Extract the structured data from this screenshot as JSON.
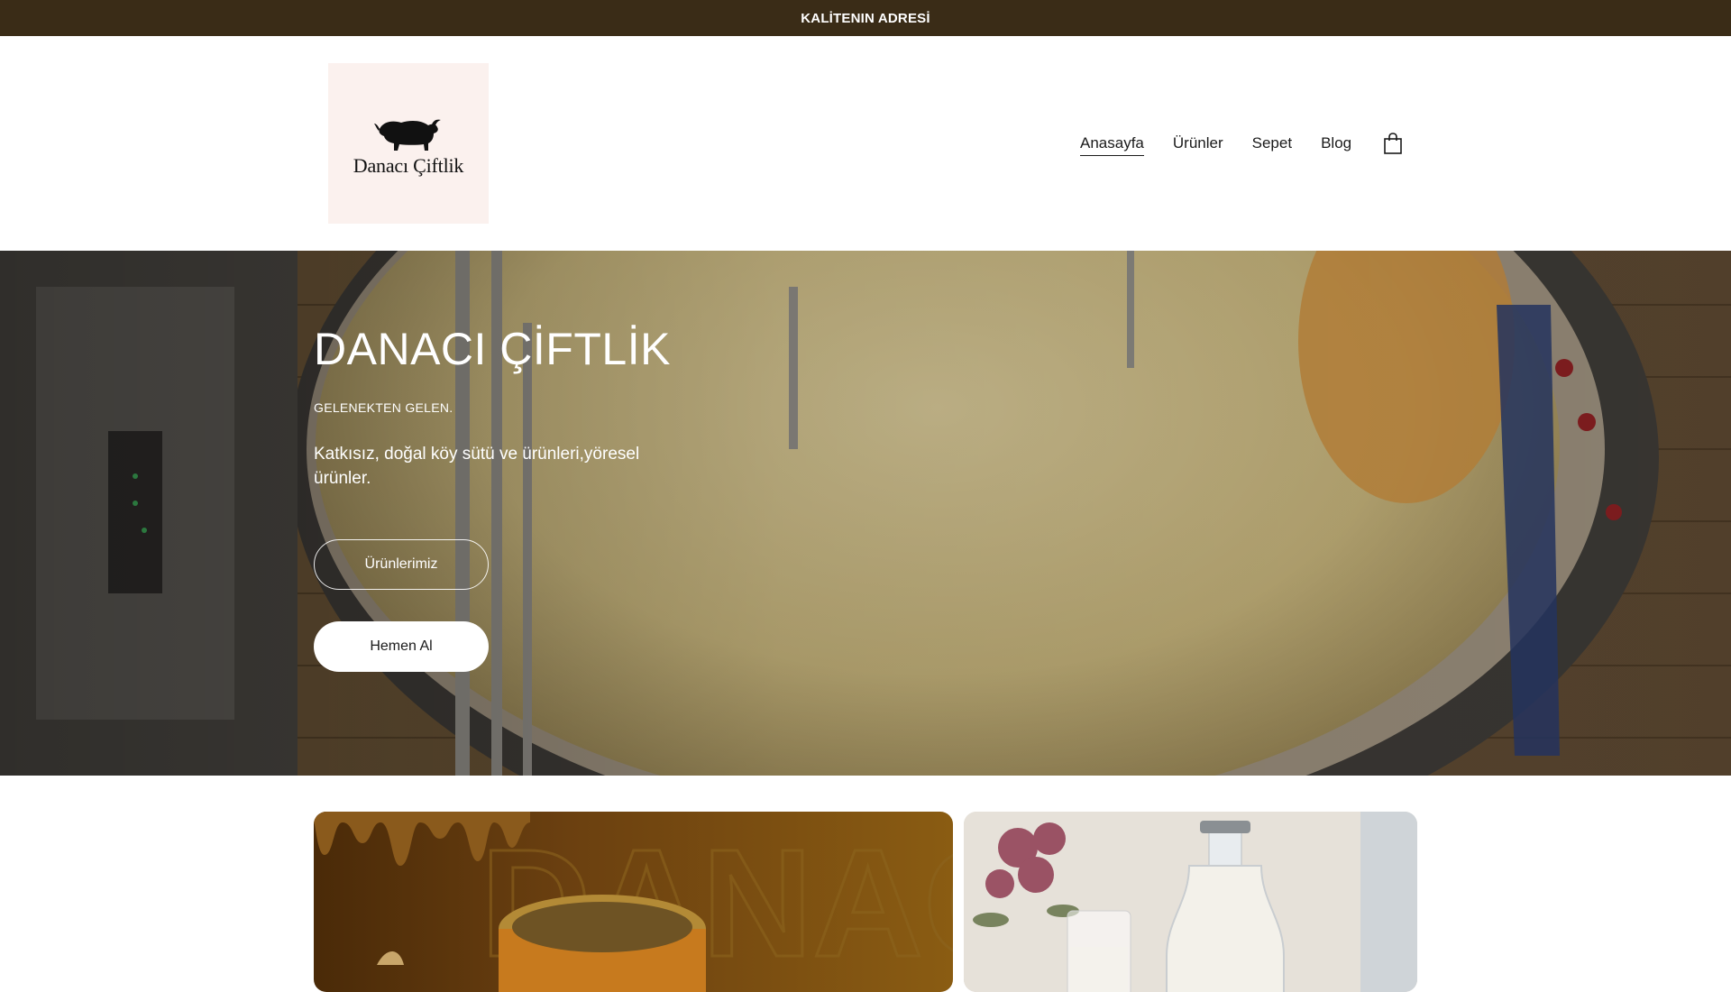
{
  "announcement": {
    "text": "KALİTENIN ADRESİ"
  },
  "brand": {
    "name": "Danacı Çiftlik",
    "logo_icon": "bull-icon"
  },
  "nav": {
    "items": [
      {
        "label": "Anasayfa",
        "active": true
      },
      {
        "label": "Ürünler",
        "active": false
      },
      {
        "label": "Sepet",
        "active": false
      },
      {
        "label": "Blog",
        "active": false
      }
    ],
    "cart_icon": "shopping-bag-icon"
  },
  "hero": {
    "title": "DANACI ÇİFTLİK",
    "subtitle": "GELENEKTEN GELEN.",
    "description": "Katkısız, doğal köy sütü ve ürünleri,yöresel ürünler.",
    "primary_button": "Ürünlerimiz",
    "secondary_button": "Hemen Al"
  },
  "cards": {
    "honey_card_overlay_text": "DANACI"
  },
  "colors": {
    "announcement_bg": "#3a2c17",
    "logo_bg": "#fbf1ee"
  }
}
